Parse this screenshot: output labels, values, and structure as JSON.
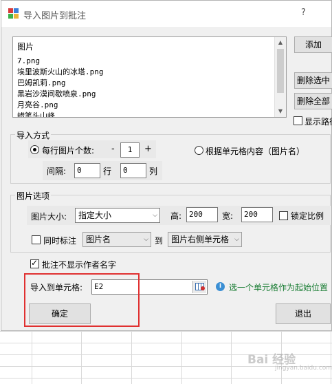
{
  "window": {
    "title": "导入图片到批注",
    "help": "?"
  },
  "image_list": {
    "header": "图片",
    "items": [
      "7.png",
      "埃里波斯火山的冰塔.png",
      "巴姆凯莉.png",
      "黑岩沙漠间歇喷泉.png",
      "月亮谷.png",
      "蜡笔头山峰"
    ]
  },
  "side_buttons": {
    "add": "添加",
    "delete_selected": "删除选中",
    "delete_all": "删除全部"
  },
  "show_path": {
    "label": "显示路径",
    "checked": false
  },
  "import_mode": {
    "legend": "导入方式",
    "per_row": {
      "label": "每行图片个数:",
      "checked": true,
      "minus": "-",
      "value": "1",
      "plus": "+"
    },
    "by_cell": {
      "label": "根据单元格内容（图片名）",
      "checked": false
    },
    "spacing": {
      "label": "间隔:",
      "rows_value": "0",
      "rows_unit": "行",
      "cols_value": "0",
      "cols_unit": "列"
    }
  },
  "image_options": {
    "legend": "图片选项",
    "size_label": "图片大小:",
    "size_value": "指定大小",
    "height_label": "高:",
    "height_value": "200",
    "width_label": "宽:",
    "width_value": "200",
    "lock_ratio": {
      "label": "锁定比例",
      "checked": false
    },
    "also_label": {
      "label": "同时标注",
      "checked": false
    },
    "label_source": "图片名",
    "to_label": "到",
    "label_target": "图片右侧单元格"
  },
  "hide_author": {
    "label": "批注不显示作者名字",
    "checked": true
  },
  "target_cell": {
    "label": "导入到单元格:",
    "value": "E2",
    "hint": "选一个单元格作为起始位置"
  },
  "footer": {
    "ok": "确定",
    "exit": "退出"
  },
  "watermark": {
    "text": "Bai 经验",
    "sub": "jingyan.baidu.com"
  },
  "colors": {
    "highlight": "#e03030",
    "hint": "#1a7d34",
    "info": "#3b8fd4"
  },
  "icons": {
    "app": "excel-app-icon",
    "info": "info-icon",
    "picker": "cell-picker-icon"
  }
}
